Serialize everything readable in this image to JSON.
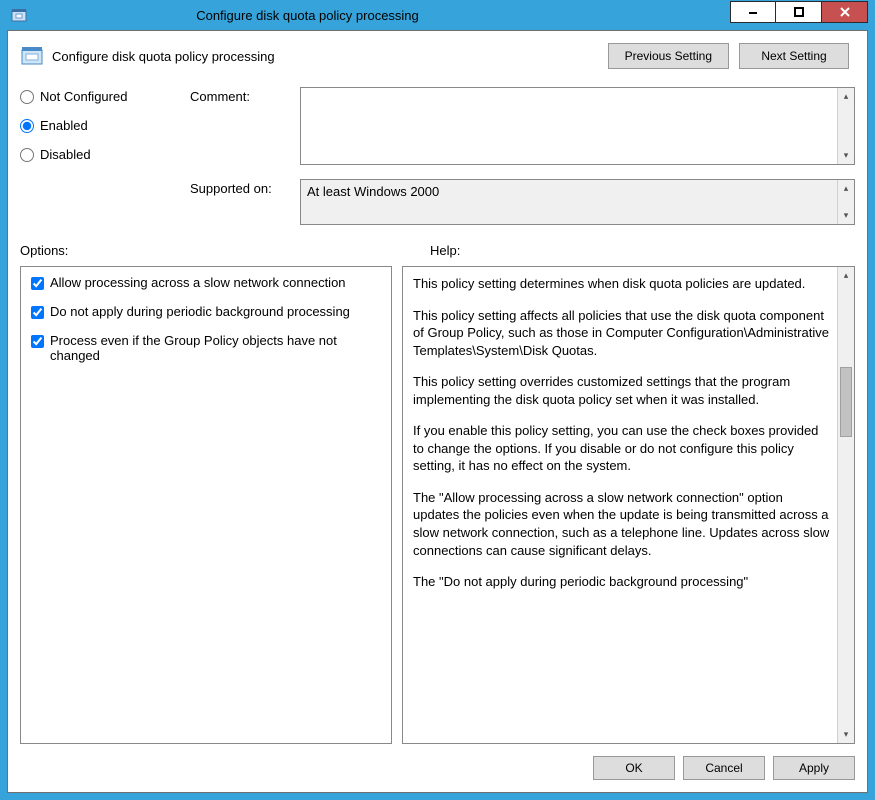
{
  "window": {
    "title": "Configure disk quota policy processing"
  },
  "header": {
    "title": "Configure disk quota policy processing",
    "prev_label": "Previous Setting",
    "next_label": "Next Setting"
  },
  "state": {
    "radios": {
      "not_configured": "Not Configured",
      "enabled": "Enabled",
      "disabled": "Disabled",
      "selected": "enabled"
    },
    "comment_label": "Comment:",
    "comment_value": "",
    "supported_label": "Supported on:",
    "supported_value": "At least Windows 2000"
  },
  "sections": {
    "options_label": "Options:",
    "help_label": "Help:"
  },
  "options": [
    {
      "label": "Allow processing across a slow network connection",
      "checked": true
    },
    {
      "label": "Do not apply during periodic background processing",
      "checked": true
    },
    {
      "label": "Process even if the Group Policy objects have not changed",
      "checked": true
    }
  ],
  "help_paragraphs": [
    "This policy setting determines when disk quota policies are updated.",
    "This policy setting affects all policies that use the disk quota component of Group Policy, such as those in Computer Configuration\\Administrative Templates\\System\\Disk Quotas.",
    "This policy setting overrides customized settings that the program implementing the disk quota policy set when it was installed.",
    "If you enable this policy setting, you can use the check boxes provided to change the options. If you disable or do not configure this policy setting, it has no effect on the system.",
    "The \"Allow processing across a slow network connection\" option updates the policies even when the update is being transmitted across a slow network connection, such as a telephone line. Updates across slow connections can cause significant delays.",
    "The \"Do not apply during periodic background processing\""
  ],
  "footer": {
    "ok": "OK",
    "cancel": "Cancel",
    "apply": "Apply"
  }
}
